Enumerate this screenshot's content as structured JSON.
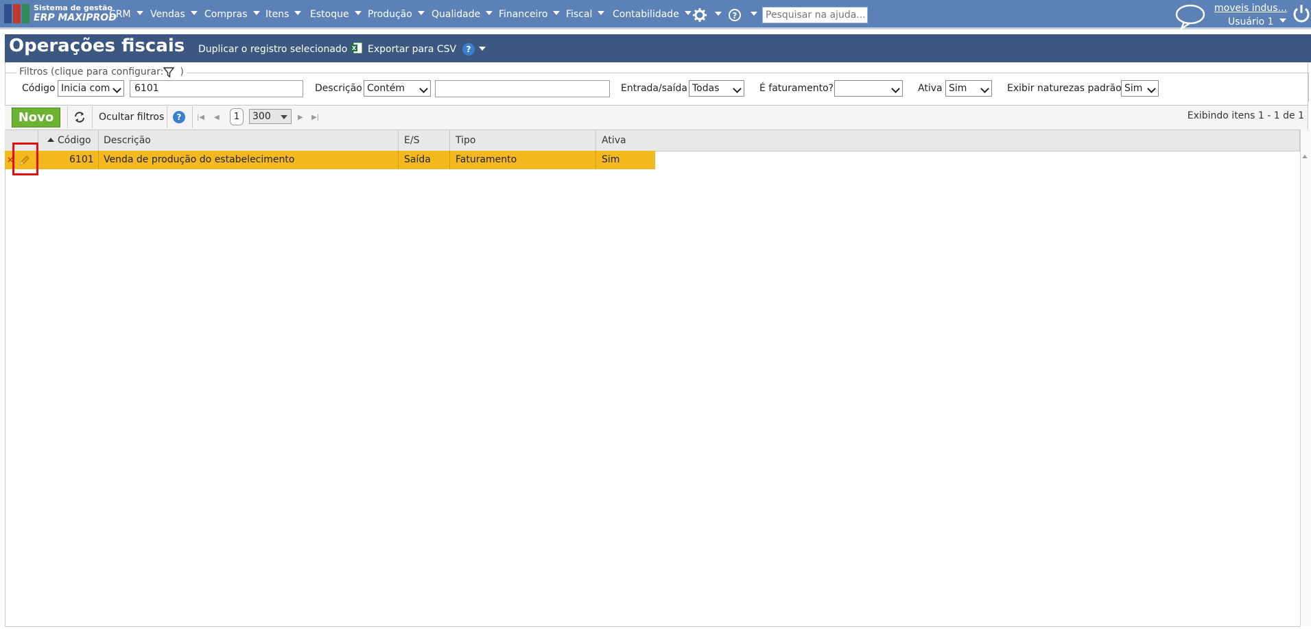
{
  "topbar": {
    "brand_line1": "Sistema de gestão",
    "brand_line2": "ERP MAXIPROD",
    "menu": [
      "CRM",
      "Vendas",
      "Compras",
      "Itens",
      "Estoque",
      "Produção",
      "Qualidade",
      "Financeiro",
      "Fiscal",
      "Contabilidade"
    ],
    "settings_icon": "gear-icon",
    "help_icon": "question-circle-icon",
    "search_placeholder": "Pesquisar na ajuda...",
    "chat_icon": "chat-bubble-icon",
    "company_link": "moveis indus...",
    "user_name": "Usuário 1",
    "power_icon": "power-icon"
  },
  "titlebar": {
    "title": "Operações fiscais",
    "duplicate_label": "Duplicar o registro selecionado",
    "export_label": "Exportar para CSV",
    "export_icon": "excel-icon",
    "help_glyph": "?"
  },
  "filters": {
    "legend": "Filtros (clique para configurar:",
    "legend_end": ")",
    "codigo_label": "Código",
    "codigo_mode": "Inicia com",
    "codigo_value": "6101",
    "descricao_label": "Descrição",
    "descricao_mode": "Contém",
    "descricao_value": "",
    "es_label": "Entrada/saída",
    "es_value": "Todas",
    "fat_label": "É faturamento?",
    "fat_value": "",
    "ativa_label": "Ativa",
    "ativa_value": "Sim",
    "padrao_label": "Exibir naturezas padrão",
    "padrao_value": "Sim"
  },
  "toolbar": {
    "new_label": "Novo",
    "hide_filters_label": "Ocultar filtros",
    "page": "1",
    "page_size": "300",
    "showing": "Exibindo itens 1 - 1 de 1"
  },
  "grid": {
    "columns": [
      "Código",
      "Descrição",
      "E/S",
      "Tipo",
      "Ativa"
    ],
    "rows": [
      {
        "codigo": "6101",
        "descricao": "Venda de produção do estabelecimento",
        "es": "Saída",
        "tipo": "Faturamento",
        "ativa": "Sim"
      }
    ]
  },
  "colors": {
    "topbar": "#5c81b6",
    "titlebar": "#3c5880",
    "selected_row": "#f5b920",
    "new_button": "#6bb431",
    "highlight_box": "#e01010"
  }
}
